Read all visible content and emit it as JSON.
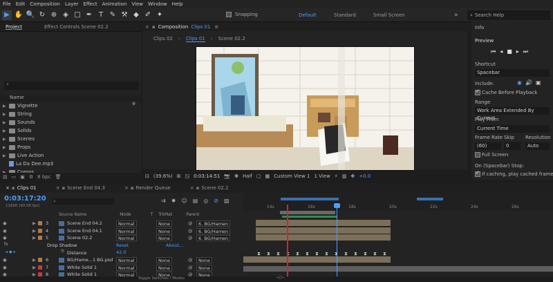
{
  "menu": [
    "File",
    "Edit",
    "Composition",
    "Layer",
    "Effect",
    "Animation",
    "View",
    "Window",
    "Help"
  ],
  "toolbar": {
    "snapping_label": "Snapping"
  },
  "workspaces": {
    "default": "Default",
    "standard": "Standard",
    "small_screen": "Small Screen"
  },
  "search_help": {
    "placeholder": "Search Help"
  },
  "project_panel": {
    "tabs": {
      "project": "Project",
      "effect_controls": "Effect Controls Scene 02.2"
    },
    "search_placeholder": "",
    "name_header": "Name",
    "items": [
      {
        "label": "Vignette",
        "type": "folder"
      },
      {
        "label": "String",
        "type": "folder"
      },
      {
        "label": "Sounds",
        "type": "folder"
      },
      {
        "label": "Solids",
        "type": "folder"
      },
      {
        "label": "Scenes",
        "type": "folder"
      },
      {
        "label": "Props",
        "type": "folder"
      },
      {
        "label": "Live Action",
        "type": "folder"
      },
      {
        "label": "La Da Dee.mp3",
        "type": "file"
      },
      {
        "label": "Comps",
        "type": "folder"
      }
    ],
    "bpc": "8 bpc"
  },
  "composition_panel": {
    "tab_prefix": "Composition",
    "tab_name": "Clips 01",
    "viewer_tabs": [
      "Clips 02",
      "Clips 01",
      "Scene 02.2"
    ],
    "zoom": "(39.6%)",
    "timecode": "0:03:14:51",
    "resolution": "Half",
    "view": "Custom View 1",
    "views_count": "1 View",
    "exposure": "+0.0"
  },
  "right_panel": {
    "info": "Info",
    "preview": "Preview",
    "shortcut_label": "Shortcut",
    "shortcut_value": "Spacebar",
    "include_label": "Include:",
    "cache_before_playback": "Cache Before Playback",
    "range_label": "Range",
    "range_value": "Work Area Extended By Current",
    "play_from_label": "Play From",
    "play_from_value": "Current Time",
    "frame_rate_label": "Frame Rate",
    "skip_label": "Skip",
    "resolution_label": "Resolution",
    "frame_rate_value": "(60)",
    "skip_value": "0",
    "resolution_value": "Auto",
    "full_screen": "Full Screen",
    "on_stop_label": "On (Spacebar) Stop:",
    "if_caching": "If caching, play cached frames"
  },
  "timeline": {
    "tabs": [
      "Clips 01",
      "Scene End 04.3",
      "Render Queue",
      "Scene 02.2"
    ],
    "current_time": "0:03:17:20",
    "frame_info": "11600 (60.00 fps)",
    "col_source": "Source Name",
    "col_mode": "Mode",
    "col_t": "T",
    "col_trkmat": "TrkMat",
    "col_parent": "Parent",
    "ruler": [
      "14s",
      "16s",
      "18s",
      "20s",
      "22s",
      "24s",
      "26s"
    ],
    "layers": [
      {
        "num": "3",
        "name": "Scene End 04.2",
        "mode": "Normal",
        "trkmat": "None",
        "parent": "6. BG/Hamen",
        "color": "#b07a4a"
      },
      {
        "num": "4",
        "name": "Scene End 04.1",
        "mode": "Normal",
        "trkmat": "None",
        "parent": "6. BG/Hamen",
        "color": "#b07a4a"
      },
      {
        "num": "5",
        "name": "Scene 02.2",
        "mode": "Normal",
        "trkmat": "None",
        "parent": "6. BG/Hamen",
        "color": "#b07a4a"
      },
      {
        "num": "6",
        "name": "BG/Hame...1 BG.psd",
        "mode": "Normal",
        "trkmat": "None",
        "parent": "None",
        "color": "#b07a4a"
      },
      {
        "num": "7",
        "name": "White Solid 1",
        "mode": "Normal",
        "trkmat": "None",
        "parent": "None",
        "color": "#c43b3b"
      },
      {
        "num": "8",
        "name": "White Solid 1",
        "mode": "Normal",
        "trkmat": "None",
        "parent": "None",
        "color": "#c43b3b"
      }
    ],
    "effect": {
      "name": "Drop Shadow",
      "reset": "Reset",
      "about": "About...",
      "prop": "Distance",
      "value": "42.0"
    },
    "footer": "Toggle Switches / Modes"
  },
  "colors": {
    "accent": "#4d9dff",
    "playhead": "#4d9dff",
    "work_area": "#8a7a60",
    "marker_red": "#e02020"
  }
}
